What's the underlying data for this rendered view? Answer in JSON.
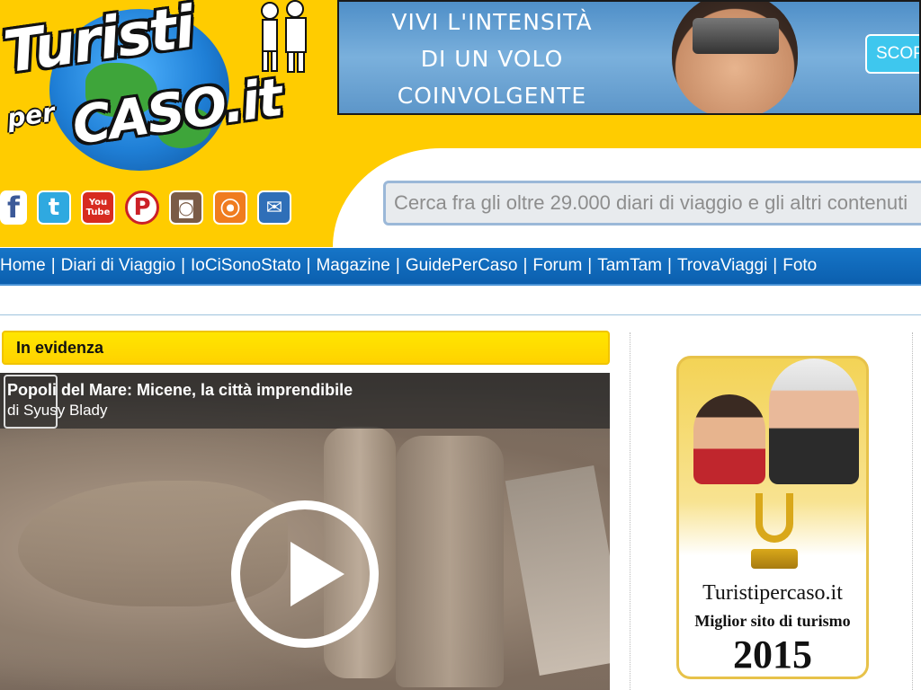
{
  "logo": {
    "line1": "Turisti",
    "line2": "per",
    "line3": "CASO.it"
  },
  "banner": {
    "lines": [
      "VIVI L'INTENSITÀ",
      "DI UN VOLO",
      "COINVOLGENTE"
    ],
    "button_label": "SCOP"
  },
  "social": [
    {
      "name": "facebook-icon",
      "glyph": "f"
    },
    {
      "name": "twitter-icon",
      "glyph": "t"
    },
    {
      "name": "youtube-icon",
      "glyph": "You\nTube"
    },
    {
      "name": "pinterest-icon",
      "glyph": "P"
    },
    {
      "name": "instagram-icon",
      "glyph": "◙"
    },
    {
      "name": "rss-icon",
      "glyph": "⦿"
    },
    {
      "name": "mail-icon",
      "glyph": "✉"
    }
  ],
  "search": {
    "placeholder": "Cerca fra gli oltre 29.000 diari di viaggio e gli altri contenuti"
  },
  "nav": {
    "items": [
      "Home",
      "Diari di Viaggio",
      "IoCiSonoStato",
      "Magazine",
      "GuidePerCaso",
      "Forum",
      "TamTam",
      "TrovaViaggi",
      "Foto"
    ],
    "separator": "|"
  },
  "evidenza": {
    "heading": "In evidenza",
    "video_title": "Popoli del Mare: Micene, la città imprendibile",
    "video_author": "di Syusy Blady"
  },
  "award": {
    "line1": "Turistipercaso.it",
    "line2": "Miglior sito di turismo",
    "line3": "2015"
  },
  "colors": {
    "header_yellow": "#ffcc00",
    "nav_blue": "#0b5fae",
    "evidenza_yellow": "#ffd200"
  }
}
